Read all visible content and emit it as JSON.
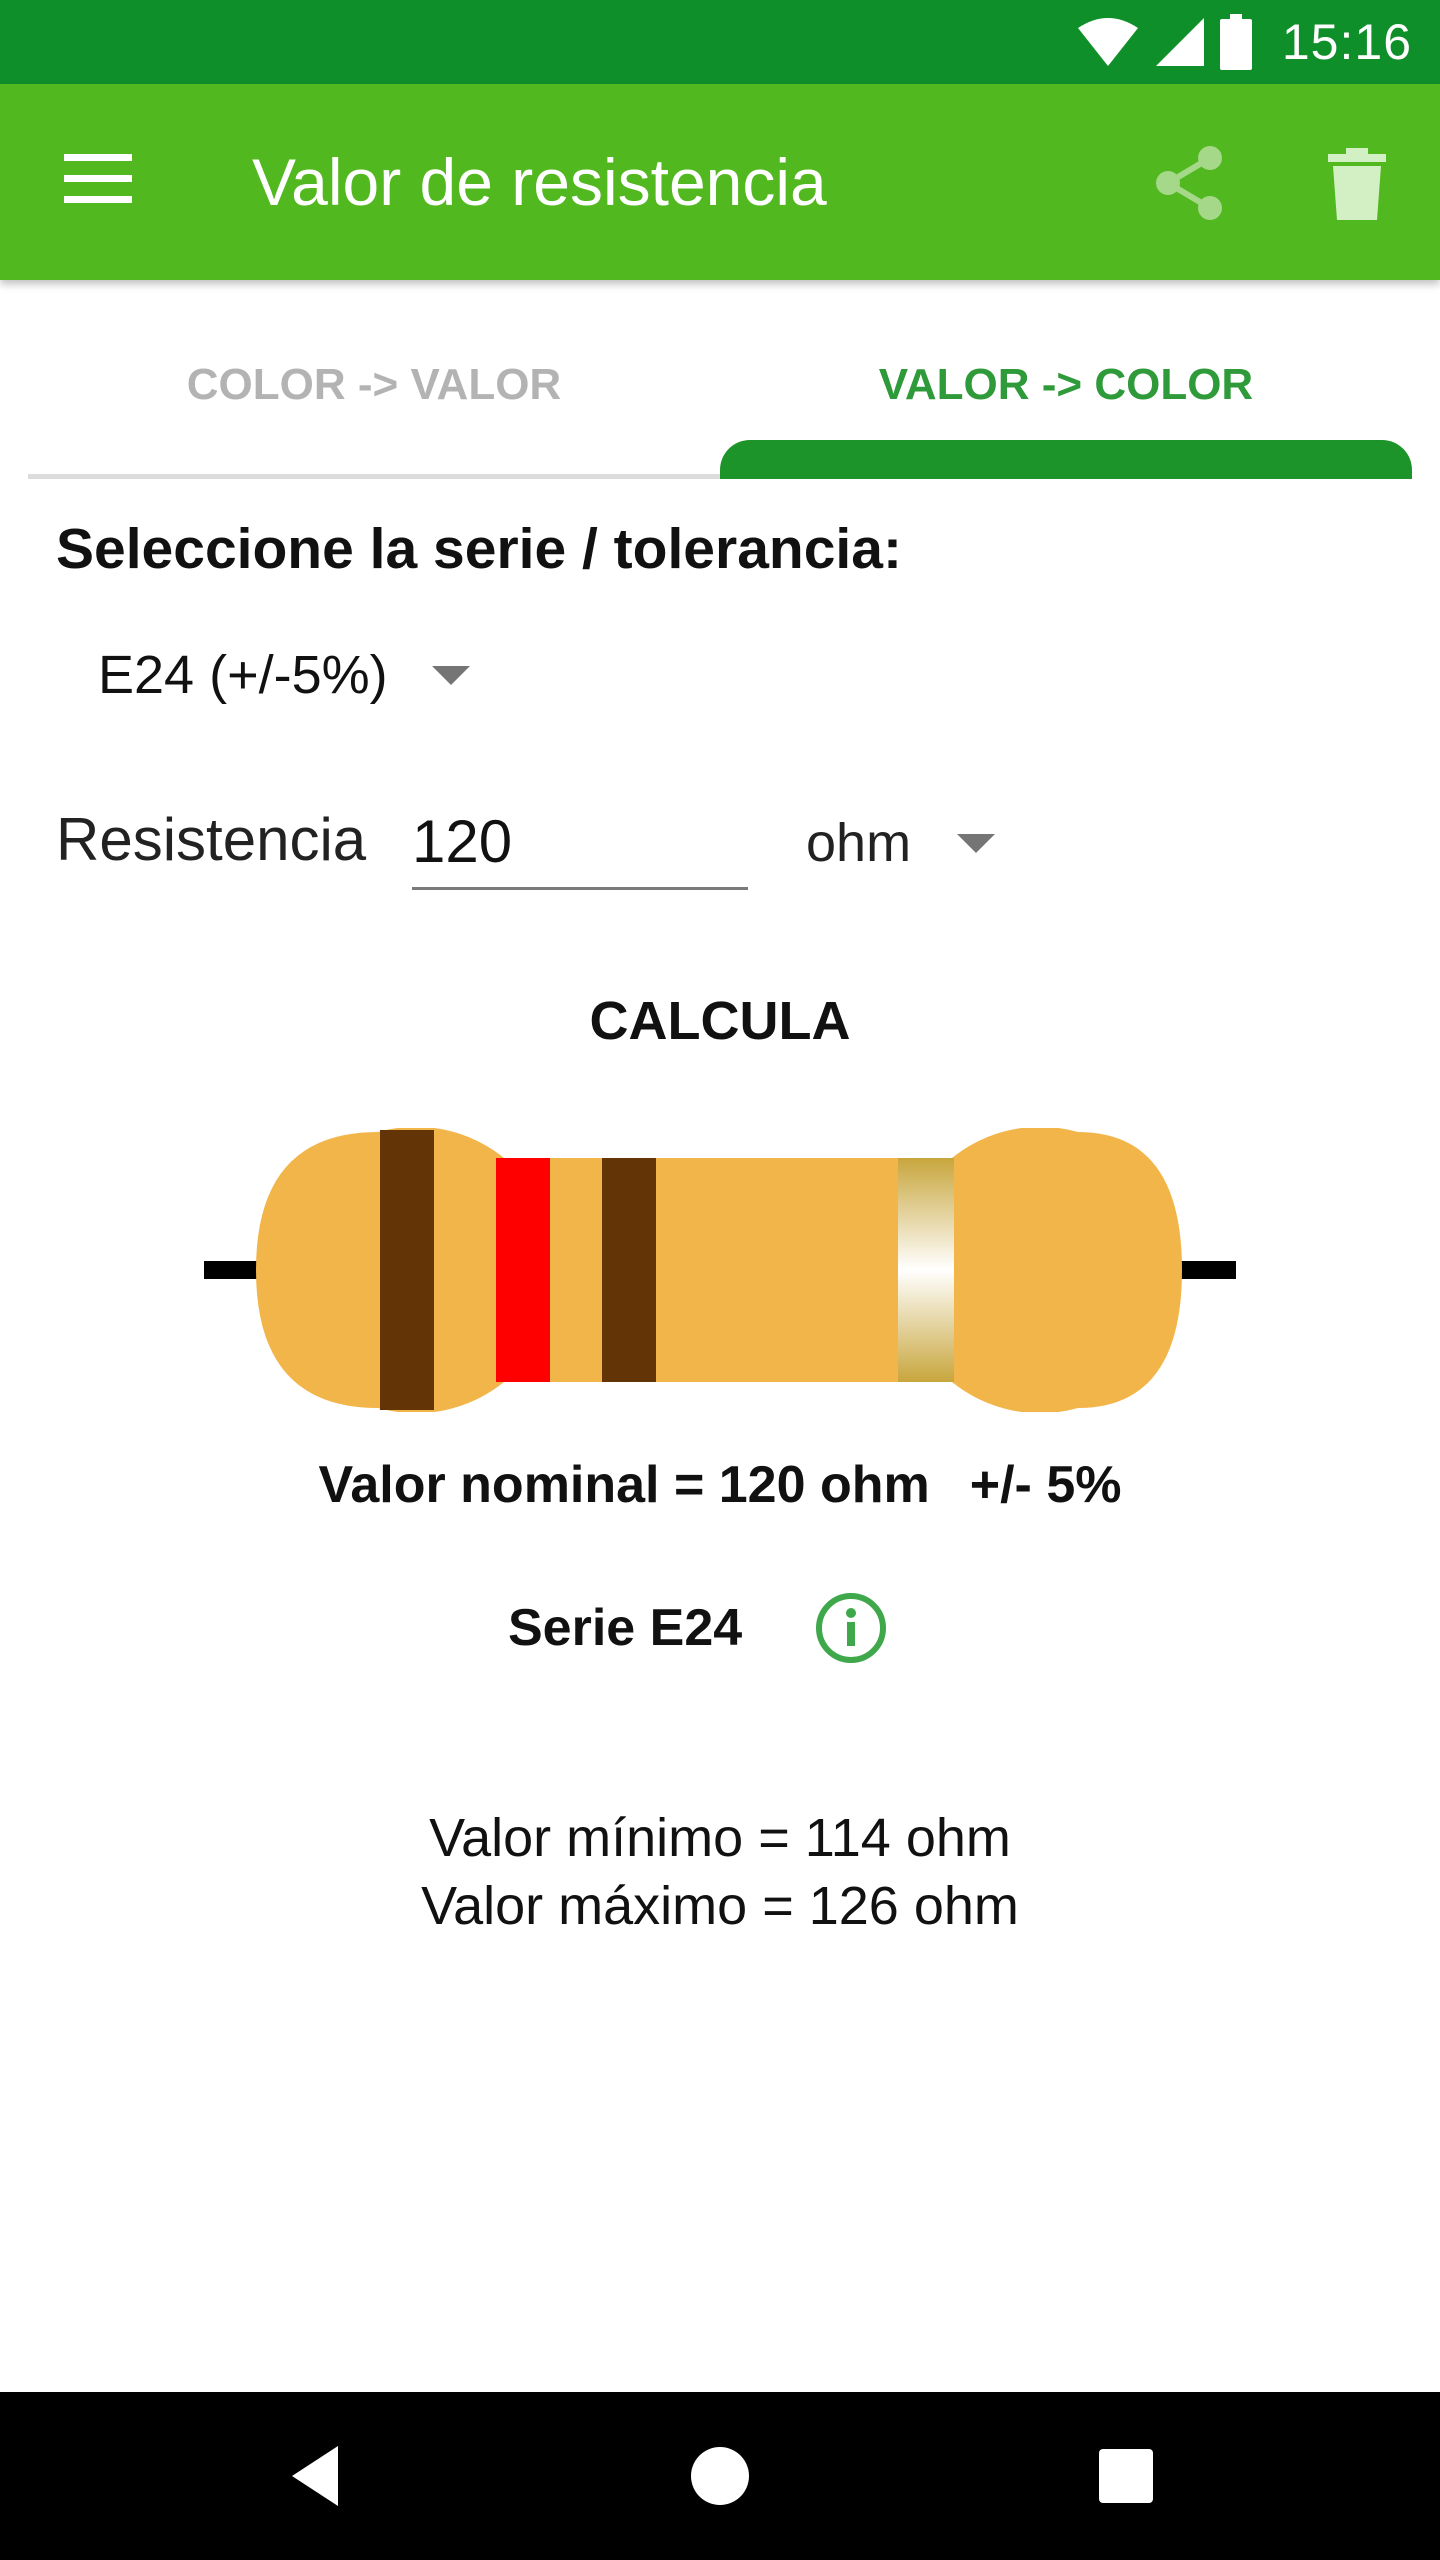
{
  "status_bar": {
    "time": "15:16"
  },
  "app_bar": {
    "title": "Valor de resistencia"
  },
  "tabs": [
    {
      "label": "COLOR -> VALOR",
      "selected": false
    },
    {
      "label": "VALOR -> COLOR",
      "selected": true
    }
  ],
  "form": {
    "series_prompt": "Seleccione la serie / tolerancia:",
    "series_value": "E24 (+/-5%)",
    "resistance_label": "Resistencia",
    "resistance_value": "120",
    "unit_value": "ohm",
    "calculate_label": "CALCULA"
  },
  "resistor": {
    "body_color": "#f2b54a",
    "bands": [
      {
        "color_name": "brown",
        "hex": "#633406"
      },
      {
        "color_name": "red",
        "hex": "#ff0000"
      },
      {
        "color_name": "brown",
        "hex": "#633406"
      },
      {
        "color_name": "gold",
        "hex": "#d4bf6a"
      }
    ]
  },
  "result": {
    "nominal": "Valor nominal = 120 ohm",
    "tolerance": "+/- 5%",
    "series": "Serie E24",
    "min": "Valor mínimo = 114 ohm",
    "max": "Valor máximo = 126 ohm"
  },
  "colors": {
    "status_bar": "#0f8f2a",
    "app_bar": "#52b81f",
    "accent": "#1d9429",
    "info_icon": "#3fa84b"
  },
  "icons": {
    "menu": "menu-icon",
    "share": "share-icon",
    "delete": "trash-icon",
    "info": "info-icon",
    "back": "back-triangle-icon",
    "home": "home-circle-icon",
    "recents": "recents-square-icon"
  }
}
